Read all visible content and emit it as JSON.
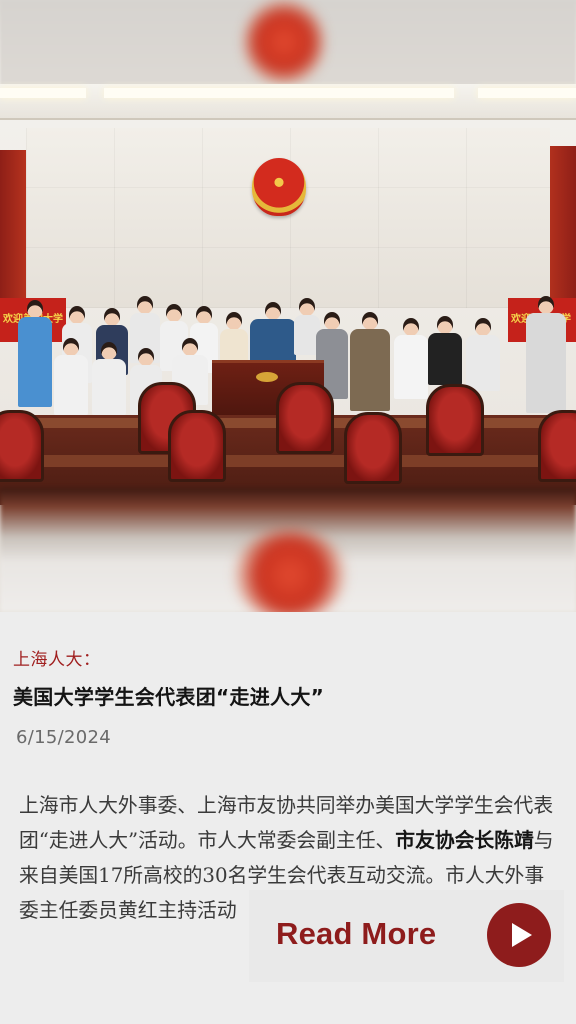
{
  "article": {
    "kicker": "上海人大：",
    "title": "美国大学学生会代表团“走进人大”",
    "date": "6/15/2024",
    "body_part1": "上海市人大外事委、上海市友协共同举办美国大学学生会代表团“走进人大”活动。市人大常委会副主任、",
    "body_bold": "市友协会长陈靖",
    "body_part2": "与来自美国17所高校的30名学生会代表互动交流。市人大外事委主任委员黄红主持活动"
  },
  "photo": {
    "banner_left": "欢迎美国大学",
    "banner_right": "欢迎美国大学"
  },
  "cta": {
    "read_more_label": "Read More",
    "icon": "play-icon"
  },
  "colors": {
    "accent": "#8e1c1c",
    "kicker": "#a01f1f",
    "background": "#ededed"
  }
}
